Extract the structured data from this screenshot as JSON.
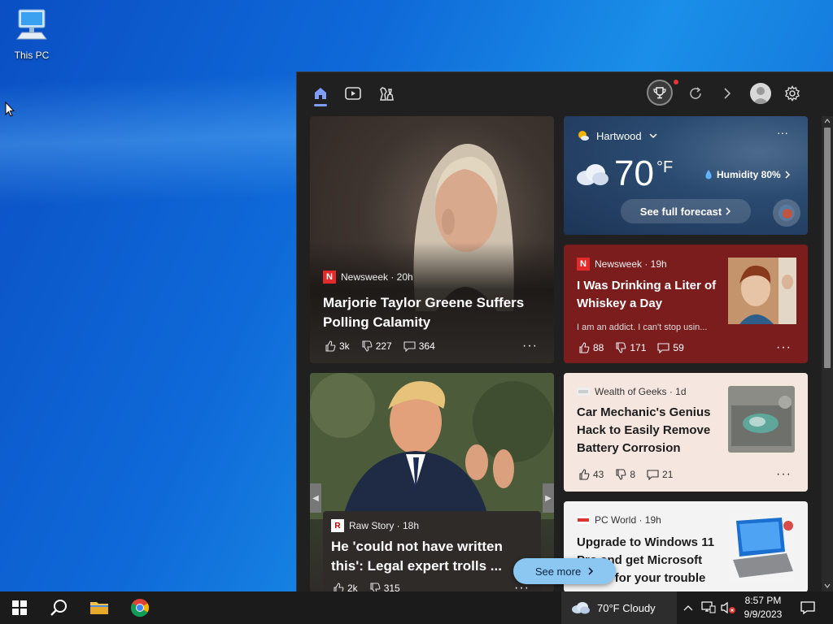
{
  "desktop": {
    "icon_label": "This PC"
  },
  "widgets": {
    "toolbar": {
      "home_icon": "home-icon",
      "video_icon": "play-video-icon",
      "games_icon": "chess-icon",
      "rewards_icon": "trophy-icon",
      "refresh_icon": "refresh-icon",
      "forward_icon": "chevron-right-icon",
      "profile_icon": "avatar-icon",
      "settings_icon": "gear-icon"
    },
    "card1": {
      "source": "Newsweek · 20h",
      "headline": "Marjorie Taylor Greene Suffers Polling Calamity",
      "likes": "3k",
      "dislikes": "227",
      "comments": "364",
      "more": "···"
    },
    "weather": {
      "location": "Hartwood",
      "temperature": "70",
      "unit": "°F",
      "humidity": "Humidity 80%",
      "forecast_label": "See full forecast",
      "more": "···"
    },
    "card2": {
      "source": "Newsweek · 19h",
      "headline": "I Was Drinking a Liter of Whiskey a Day",
      "snippet": "I am an addict. I can't stop usin...",
      "likes": "88",
      "dislikes": "171",
      "comments": "59",
      "more": "···"
    },
    "card3": {
      "source": "Raw Story · 18h",
      "headline": "He 'could not have written this': Legal expert trolls ...",
      "likes": "2k",
      "dislikes": "315",
      "more": "···"
    },
    "card4": {
      "source": "Wealth of Geeks · 1d",
      "headline": "Car Mechanic's Genius Hack to Easily Remove Battery Corrosion",
      "likes": "43",
      "dislikes": "8",
      "comments": "21",
      "more": "···"
    },
    "card5": {
      "source": "PC World · 19h",
      "headline": "Upgrade to Windows 11 Pro and get Microsoft Office for your trouble"
    },
    "see_more_label": "See more"
  },
  "taskbar": {
    "weather": "70°F Cloudy",
    "time": "8:57 PM",
    "date": "9/9/2023"
  },
  "colors": {
    "desktop_blue": "#0f6ad8",
    "panel_bg": "#202020",
    "red_card": "#7b1c1d",
    "accent": "#7f9dff"
  }
}
